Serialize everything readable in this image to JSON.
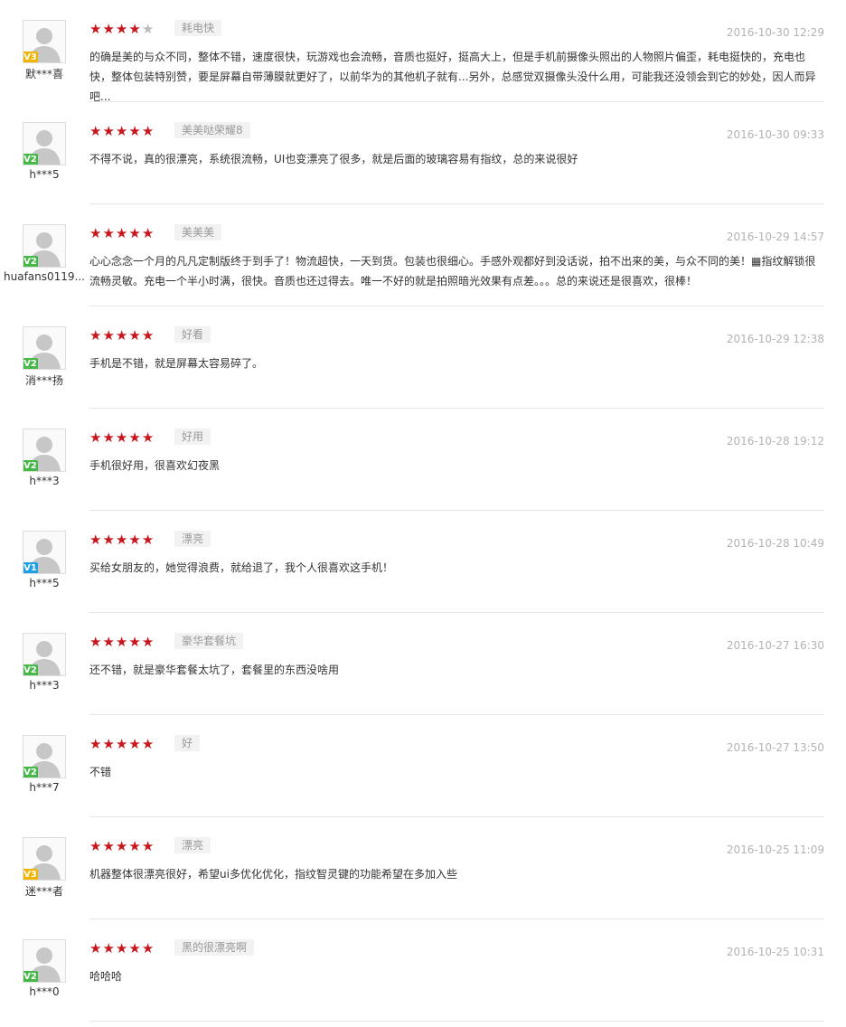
{
  "reviews": [
    {
      "user": "默***喜",
      "badge": "V3",
      "badge_color": "gold",
      "stars": 4,
      "tag": "耗电快",
      "date": "2016-10-30 12:29",
      "content": "的确是美的与众不同，整体不错，速度很快，玩游戏也会流畅，音质也挺好，挺高大上，但是手机前摄像头照出的人物照片偏歪，耗电挺快的，充电也快，整体包装特别赞，要是屏幕自带薄膜就更好了，以前华为的其他机子就有...另外，总感觉双摄像头没什么用，可能我还没领会到它的妙处，因人而异吧..."
    },
    {
      "user": "h***5",
      "badge": "V2",
      "badge_color": "green",
      "stars": 5,
      "tag": "美美哒荣耀8",
      "date": "2016-10-30 09:33",
      "content": "不得不说，真的很漂亮，系统很流畅，UI也变漂亮了很多，就是后面的玻璃容易有指纹，总的来说很好"
    },
    {
      "user": "huafans0119...",
      "badge": "V2",
      "badge_color": "green",
      "stars": 5,
      "tag": "美美美",
      "date": "2016-10-29 14:57",
      "content": "心心念念一个月的凡凡定制版终于到手了！物流超快，一天到货。包装也很细心。手感外观都好到没话说，拍不出来的美，与众不同的美！▦指纹解锁很流畅灵敏。充电一个半小时满，很快。音质也还过得去。唯一不好的就是拍照暗光效果有点差。。。总的来说还是很喜欢，很棒！"
    },
    {
      "user": "消***扬",
      "badge": "V2",
      "badge_color": "green",
      "stars": 5,
      "tag": "好看",
      "date": "2016-10-29 12:38",
      "content": "手机是不错，就是屏幕太容易碎了。"
    },
    {
      "user": "h***3",
      "badge": "V2",
      "badge_color": "green",
      "stars": 5,
      "tag": "好用",
      "date": "2016-10-28 19:12",
      "content": "手机很好用，很喜欢幻夜黑"
    },
    {
      "user": "h***5",
      "badge": "V1",
      "badge_color": "blue",
      "stars": 5,
      "tag": "漂亮",
      "date": "2016-10-28 10:49",
      "content": "买给女朋友的，她觉得浪费，就给退了，我个人很喜欢这手机！"
    },
    {
      "user": "h***3",
      "badge": "V2",
      "badge_color": "green",
      "stars": 5,
      "tag": "豪华套餐坑",
      "date": "2016-10-27 16:30",
      "content": "还不错，就是豪华套餐太坑了，套餐里的东西没啥用"
    },
    {
      "user": "h***7",
      "badge": "V2",
      "badge_color": "green",
      "stars": 5,
      "tag": "好",
      "date": "2016-10-27 13:50",
      "content": "不错"
    },
    {
      "user": "迷***者",
      "badge": "V3",
      "badge_color": "gold",
      "stars": 5,
      "tag": "漂亮",
      "date": "2016-10-25 11:09",
      "content": "机器整体很漂亮很好，希望ui多优化优化，指纹智灵键的功能希望在多加入些"
    },
    {
      "user": "h***0",
      "badge": "V2",
      "badge_color": "green",
      "stars": 5,
      "tag": "黑的很漂亮啊",
      "date": "2016-10-25 10:31",
      "content": "哈哈哈"
    }
  ]
}
